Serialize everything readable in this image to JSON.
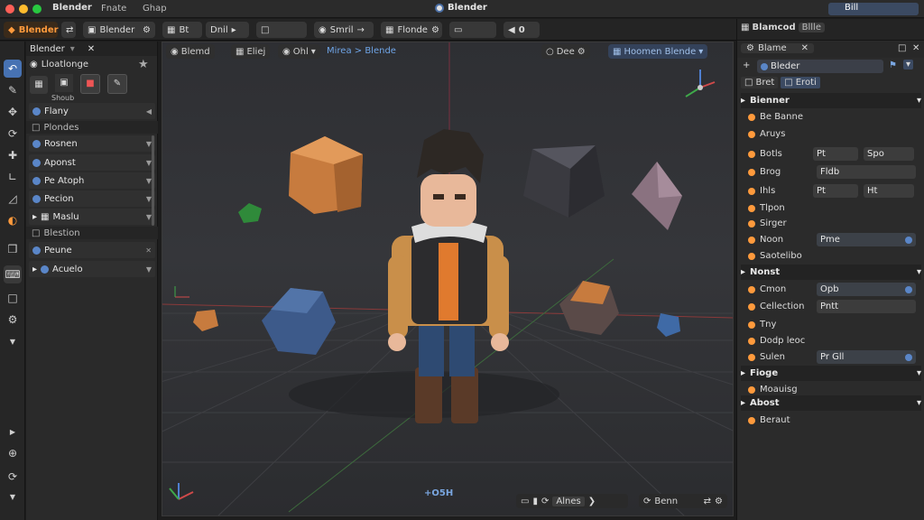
{
  "window": {
    "title": "Blender"
  },
  "menubar": {
    "app_label": "Blender",
    "menu_items": [
      "Fnate",
      "Ghap"
    ],
    "chips": [
      "Blender",
      "Bt",
      "Dnil",
      "",
      "Smril",
      "Flonde",
      "",
      "0"
    ]
  },
  "top_right": {
    "search_label": "Bill"
  },
  "left_panel": {
    "tab_label": "Blender",
    "section_title": "Lloatlonge",
    "tool_caption": "Shoub",
    "rows": [
      "Flany",
      "Rosnen",
      "Aponst",
      "Pe Atoph",
      "Pecion",
      "Maslu"
    ],
    "section2": "Plondes",
    "section3": "Blestion",
    "rows2": [
      "Peune",
      "Acuelo"
    ]
  },
  "viewport": {
    "header_items": [
      "Blemd",
      "Eliej",
      "Ohl",
      "Mirea > Blende"
    ],
    "right_items": [
      "Dee",
      "Hoomen Blende"
    ],
    "bottom_label": "Alnes",
    "bottom_right": "Benn",
    "footer_glyph": "+O5H"
  },
  "right_panel": {
    "title": "Blamcod",
    "title_tag": "Bllle",
    "tab": "Blame",
    "search": "Bleder",
    "tabs": [
      "Bret",
      "Eroti"
    ],
    "sections": [
      {
        "label": "Bienner",
        "type": "hdr"
      },
      {
        "label": "Be Banne",
        "type": "item"
      },
      {
        "label": "Aruys",
        "type": "item"
      },
      {
        "label": "Botls",
        "type": "field",
        "a": "Pt",
        "b": "Spo"
      },
      {
        "label": "Brog",
        "type": "field2",
        "a": "Fldb"
      },
      {
        "label": "Ihls",
        "type": "field",
        "a": "Pt",
        "b": "Ht"
      },
      {
        "label": "Tlpon",
        "type": "item"
      },
      {
        "label": "Sirger",
        "type": "item"
      },
      {
        "label": "Noon",
        "type": "field3",
        "a": "Pme"
      },
      {
        "label": "Saotelibo",
        "type": "item"
      },
      {
        "label": "Nonst",
        "type": "hdr"
      },
      {
        "label": "Cmon",
        "type": "field3",
        "a": "Opb"
      },
      {
        "label": "Cellection",
        "type": "field2",
        "a": "Pntt"
      },
      {
        "label": "Tny",
        "type": "item"
      },
      {
        "label": "Dodp leoc",
        "type": "item"
      },
      {
        "label": "Sulen",
        "type": "field3",
        "a": "Pr Gll"
      },
      {
        "label": "Fioge",
        "type": "hdr"
      },
      {
        "label": "Moauisg",
        "type": "item"
      },
      {
        "label": "Abost",
        "type": "hdr"
      },
      {
        "label": "Beraut",
        "type": "item"
      }
    ]
  },
  "colors": {
    "accent_orange": "#ff9a3c",
    "accent_blue": "#4772b3"
  }
}
